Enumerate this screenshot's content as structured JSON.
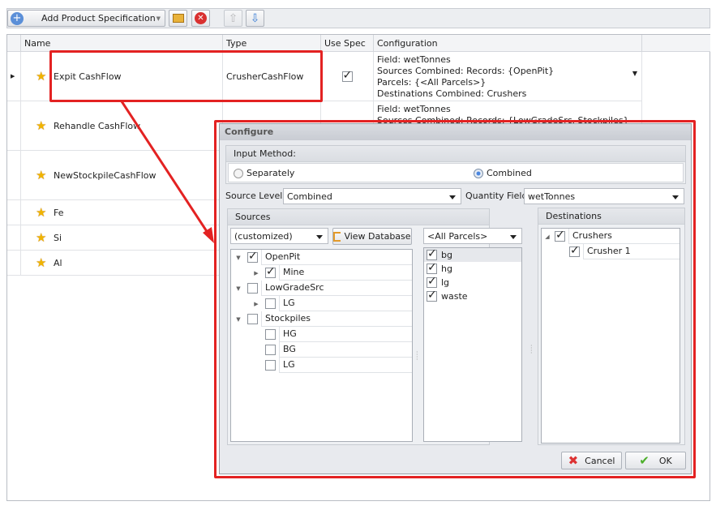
{
  "toolbar": {
    "add_label": "Add Product Specification"
  },
  "grid": {
    "columns": [
      "Name",
      "Type",
      "Use Spec",
      "Configuration"
    ],
    "rows": [
      {
        "name": "Expit CashFlow",
        "type": "CrusherCashFlow",
        "use_spec": true,
        "config": [
          "Field: wetTonnes",
          "Sources Combined: Records: {OpenPit}",
          "Parcels: {<All Parcels>}",
          "Destinations Combined: Crushers"
        ]
      },
      {
        "name": "Rehandle CashFlow",
        "config": [
          "Field: wetTonnes",
          "Sources Combined: Records: {LowGradeSrc, Stockpiles}"
        ]
      },
      {
        "name": "NewStockpileCashFlow"
      },
      {
        "name": "Fe"
      },
      {
        "name": "Si"
      },
      {
        "name": "Al"
      }
    ]
  },
  "dialog": {
    "title": "Configure",
    "input_method": {
      "label": "Input Method:",
      "separately": "Separately",
      "combined": "Combined",
      "selected": "Combined"
    },
    "source_levels": {
      "label": "Source Levels",
      "value": "Combined"
    },
    "quantity_field": {
      "label": "Quantity Field",
      "value": "wetTonnes"
    },
    "sources": {
      "title": "Sources",
      "filter": "(customized)",
      "view_db": "View Database",
      "tree": [
        {
          "label": "OpenPit",
          "checked": true,
          "level": 0
        },
        {
          "label": "Mine",
          "checked": true,
          "level": 1
        },
        {
          "label": "LowGradeSrc",
          "checked": false,
          "level": 0
        },
        {
          "label": "LG",
          "checked": false,
          "level": 1
        },
        {
          "label": "Stockpiles",
          "checked": false,
          "level": 0
        },
        {
          "label": "HG",
          "checked": false,
          "level": 1
        },
        {
          "label": "BG",
          "checked": false,
          "level": 1
        },
        {
          "label": "LG",
          "checked": false,
          "level": 1
        }
      ]
    },
    "parcels": {
      "filter": "<All Parcels>",
      "items": [
        {
          "label": "bg",
          "checked": true
        },
        {
          "label": "hg",
          "checked": true
        },
        {
          "label": "lg",
          "checked": true
        },
        {
          "label": "waste",
          "checked": true
        }
      ]
    },
    "destinations": {
      "title": "Destinations",
      "tree": [
        {
          "label": "Crushers",
          "checked": true
        },
        {
          "label": "Crusher 1",
          "checked": true
        }
      ]
    },
    "cancel": "Cancel",
    "ok": "OK"
  }
}
